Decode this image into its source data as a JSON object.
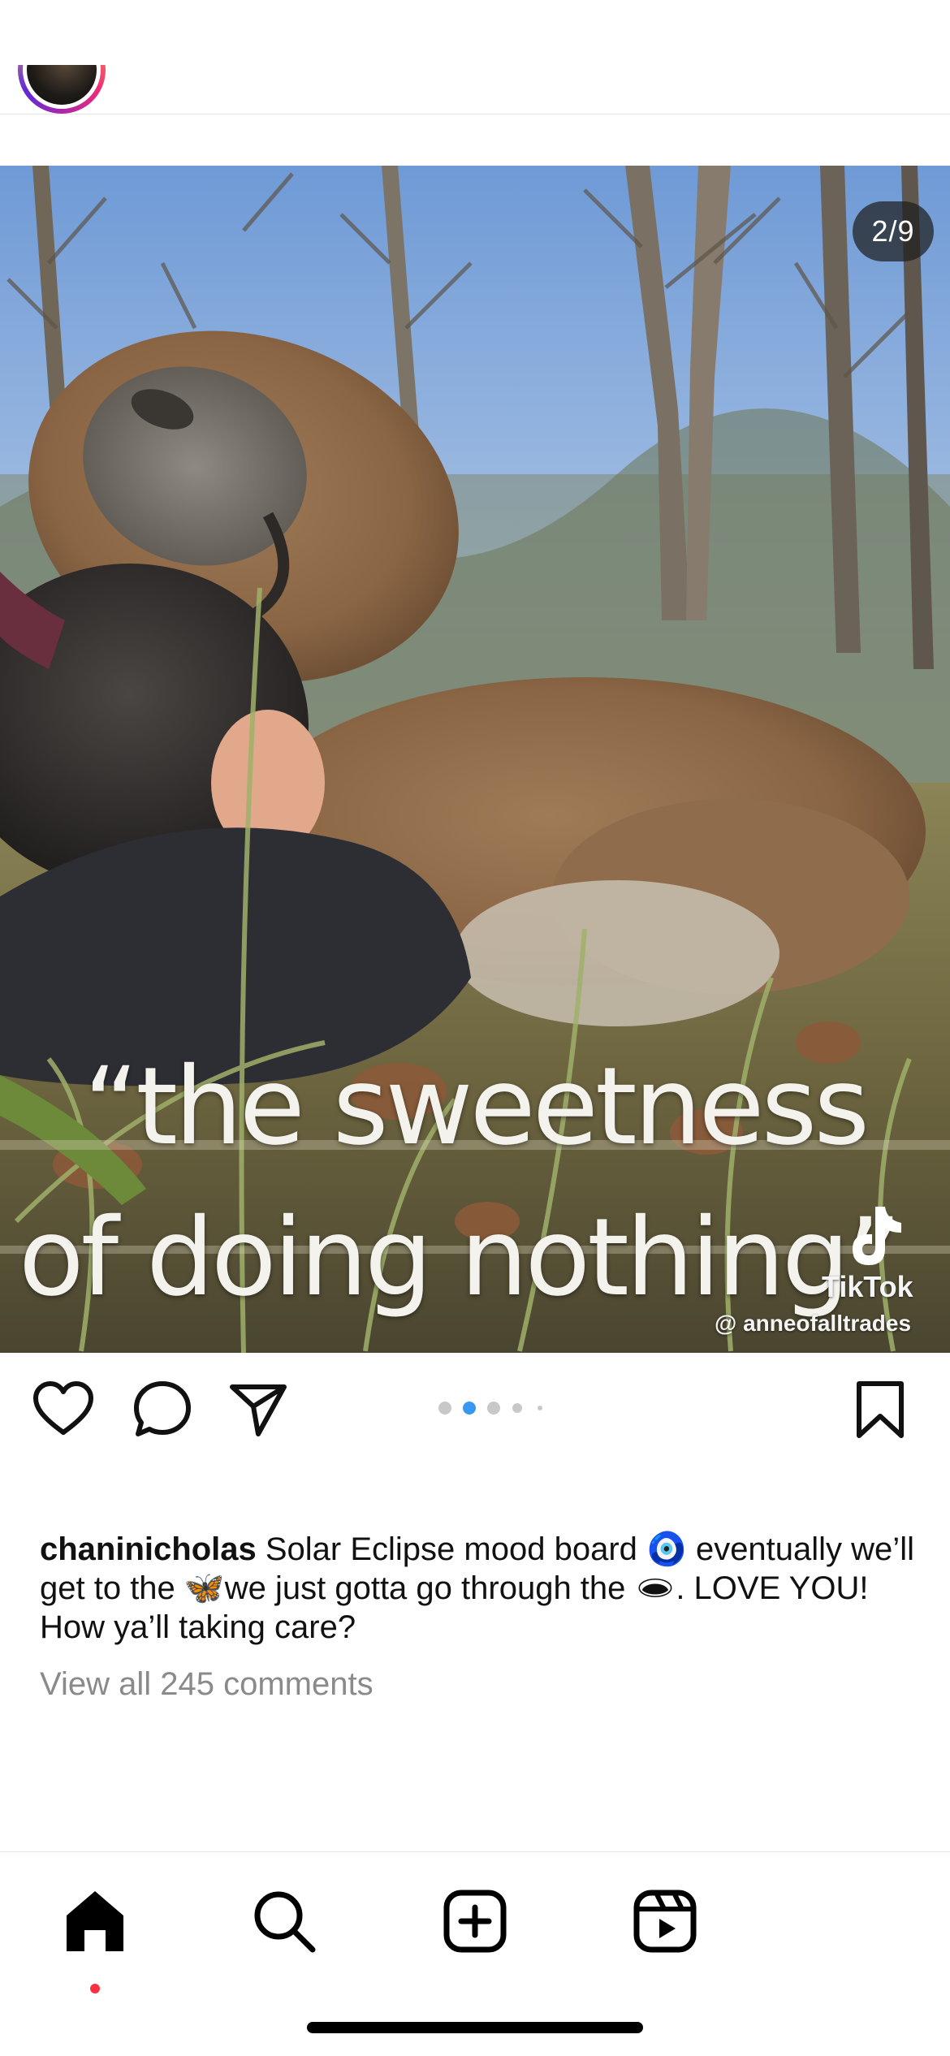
{
  "post": {
    "media_counter": "2/9",
    "overlay_line_1": "“the sweetness",
    "overlay_line_2": "of doing nothing”",
    "watermark_brand": "TikTok",
    "watermark_handle": "@ anneofalltrades",
    "carousel": {
      "total_dots_visible": 5,
      "active_dot_index": 1
    }
  },
  "caption": {
    "username": "chaninicholas",
    "text_1": " Solar Eclipse mood board ",
    "emoji_1": "🧿",
    "text_2": " eventually we’ll get to the ",
    "emoji_2": "🦋",
    "text_3": "we just gotta go through the ",
    "emoji_3": "🕳",
    "text_4": ". LOVE YOU! How ya’ll taking care?"
  },
  "comments": {
    "view_all_label": "View all 245 comments"
  },
  "tab_bar": {
    "items": [
      {
        "name": "home",
        "icon": "home-icon",
        "active": true
      },
      {
        "name": "search",
        "icon": "search-icon",
        "active": false
      },
      {
        "name": "create",
        "icon": "plus-square-icon",
        "active": false
      },
      {
        "name": "reels",
        "icon": "reels-icon",
        "active": false
      }
    ],
    "notification_dot_color": "#ff3040"
  },
  "colors": {
    "active_dot": "#3897f0",
    "inactive_dot": "#c8c8c8",
    "muted_text": "#8a8a8a"
  }
}
